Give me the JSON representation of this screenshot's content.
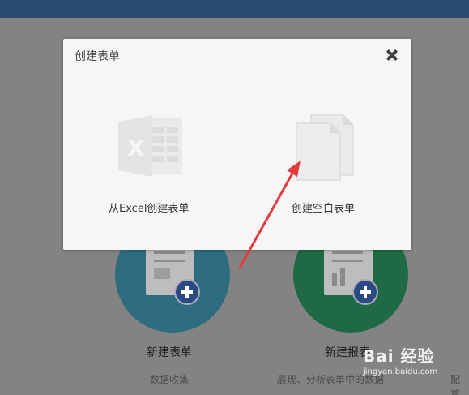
{
  "modal": {
    "title": "创建表单",
    "options": [
      {
        "label": "从Excel创建表单",
        "icon": "excel-file-icon"
      },
      {
        "label": "创建空白表单",
        "icon": "blank-document-icon"
      }
    ],
    "close_icon": "close-icon"
  },
  "background": {
    "cards": [
      {
        "title": "新建表单",
        "subtitle": "数据收集",
        "color": "#2d6d7f"
      },
      {
        "title": "新建报表",
        "subtitle": "展现、分析表单中的数据",
        "color": "#1f6a44"
      }
    ],
    "third_subtitle": "配置"
  },
  "watermark": {
    "brand": "Bai 经验",
    "url": "jingyan.baidu.com"
  },
  "colors": {
    "header": "#2b4a6f",
    "overlay": "#848384",
    "modal_bg": "#f7f6f7",
    "arrow": "#e23b3b"
  }
}
